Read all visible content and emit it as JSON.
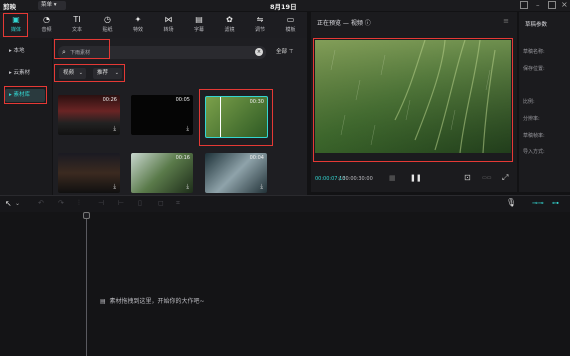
{
  "app": {
    "logo": "剪映",
    "menu": "菜单",
    "date": "8月19日"
  },
  "tools": [
    {
      "icon": "import-icon",
      "glyph": "▣",
      "label": "媒体"
    },
    {
      "icon": "audio-icon",
      "glyph": "◔",
      "label": "音频"
    },
    {
      "icon": "text-icon",
      "glyph": "TI",
      "label": "文本"
    },
    {
      "icon": "sticker-icon",
      "glyph": "◷",
      "label": "贴纸"
    },
    {
      "icon": "effects-icon",
      "glyph": "✦",
      "label": "特效"
    },
    {
      "icon": "transition-icon",
      "glyph": "⋈",
      "label": "转场"
    },
    {
      "icon": "captions-icon",
      "glyph": "▤",
      "label": "字幕"
    },
    {
      "icon": "filter-icon",
      "glyph": "✿",
      "label": "滤镜"
    },
    {
      "icon": "adjust-icon",
      "glyph": "⇋",
      "label": "调节"
    },
    {
      "icon": "template-icon",
      "glyph": "▭",
      "label": "模板"
    }
  ],
  "sidebar": {
    "items": [
      "本地",
      "云素材",
      "素材库"
    ]
  },
  "search": {
    "placeholder": "下雨素材"
  },
  "filters": {
    "all_label": "全部",
    "type": "视频",
    "sort": "推荐"
  },
  "thumbs": [
    {
      "duration": "00:26"
    },
    {
      "duration": "00:05"
    },
    {
      "duration": "00:30"
    },
    {
      "duration": ""
    },
    {
      "duration": "00:16"
    },
    {
      "duration": "00:04"
    }
  ],
  "player": {
    "title": "正在预览 — 视频",
    "current_time": "00:00:07:13",
    "total_time": "00:00:30:00"
  },
  "params": {
    "title": "草稿参数",
    "rows": [
      "草稿名称:",
      "保存位置:",
      "比例:",
      "分辨率:",
      "草稿帧率:",
      "导入方式:"
    ]
  },
  "timeline": {
    "hint": "素材拖拽到这里，开始你的大作吧~"
  },
  "colors": {
    "accent": "#33d6d1",
    "highlight": "#e53935"
  }
}
